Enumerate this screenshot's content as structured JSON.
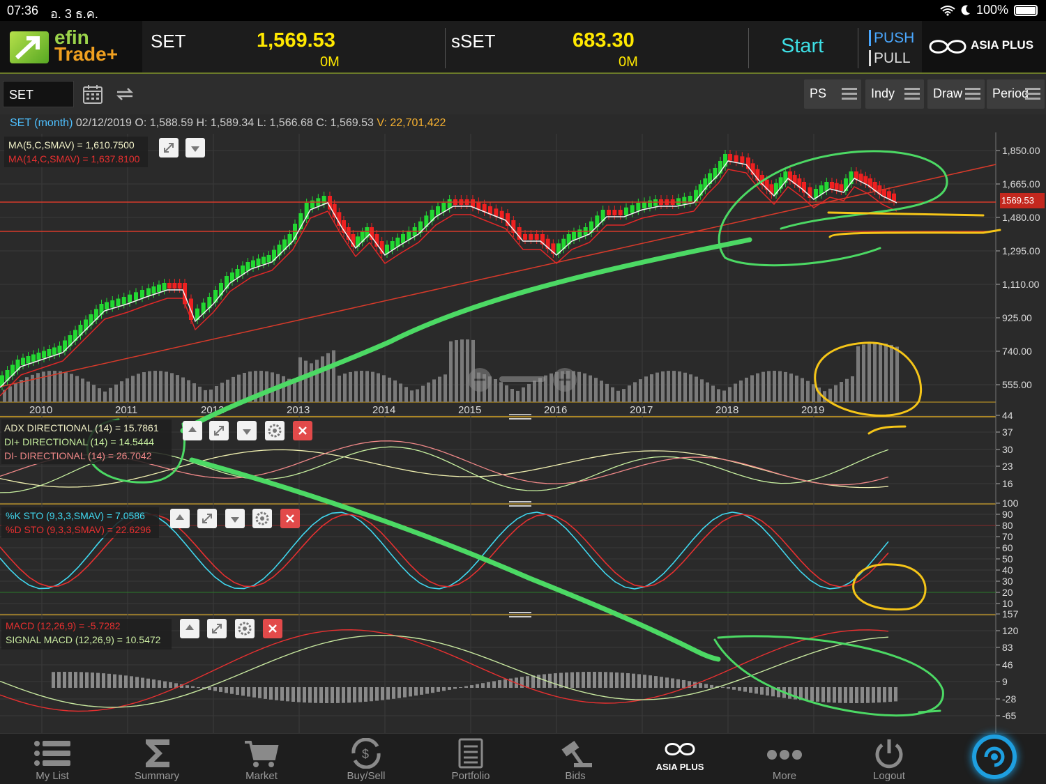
{
  "status_bar": {
    "time": "07:36",
    "date": "อ. 3 ธ.ค.",
    "battery": "100%"
  },
  "header": {
    "logo_line1": "efin",
    "logo_line2": "Trade+",
    "set": {
      "name": "SET",
      "value": "1,569.53",
      "volume": "0M"
    },
    "sset": {
      "name": "sSET",
      "value": "683.30",
      "volume": "0M"
    },
    "start_label": "Start",
    "push_label": "PUSH",
    "pull_label": "PULL",
    "broker_logo": "ASIA PLUS"
  },
  "toolbar": {
    "symbol": "SET",
    "calendar_icon": "calendar-icon",
    "refresh_icon": "refresh-icon",
    "buttons": [
      "PS",
      "Indy",
      "Draw",
      "Period"
    ]
  },
  "ohlc": {
    "symbol": "SET (month)",
    "date": "02/12/2019",
    "o_label": "O:",
    "o": "1,588.59",
    "h_label": "H:",
    "h": "1,589.34",
    "l_label": "L:",
    "l": "1,566.68",
    "c_label": "C:",
    "c": "1,569.53",
    "v_label": "V:",
    "v": "22,701,422"
  },
  "price_panel": {
    "legend": [
      "MA(5,C,SMAV) = 1,610.7500",
      "MA(14,C,SMAV) = 1,637.8100"
    ],
    "last_price_tag": "1569.53"
  },
  "adx_panel": {
    "legend": [
      "ADX DIRECTIONAL (14) = 15.7861",
      "DI+ DIRECTIONAL (14) = 14.5444",
      "DI- DIRECTIONAL (14) = 26.7042"
    ]
  },
  "sto_panel": {
    "legend": [
      "%K STO (9,3,3,SMAV) = 7.0586",
      "%D STO (9,3,3,SMAV) = 22.6296"
    ]
  },
  "macd_panel": {
    "legend": [
      "MACD (12,26,9) = -5.7282",
      "SIGNAL MACD (12,26,9) = 10.5472"
    ]
  },
  "chart_data": {
    "type": "line",
    "title": "SET (month)",
    "x_ticks": [
      "2010",
      "2011",
      "2012",
      "2013",
      "2014",
      "2015",
      "2016",
      "2017",
      "2018",
      "2019"
    ],
    "price_axis": [
      "1,850.00",
      "1,665.00",
      "1,480.00",
      "1,295.00",
      "1,110.00",
      "925.00",
      "740.00",
      "555.00"
    ],
    "adx_axis": [
      "44",
      "37",
      "30",
      "23",
      "16"
    ],
    "sto_axis": [
      "100",
      "90",
      "80",
      "70",
      "60",
      "50",
      "40",
      "30",
      "20",
      "10"
    ],
    "macd_axis": [
      "157",
      "120",
      "83",
      "46",
      "9",
      "-28",
      "-65"
    ],
    "series": [
      {
        "name": "MA(5,C,SMAV)",
        "color": "#ffffff"
      },
      {
        "name": "MA(14,C,SMAV)",
        "color": "#e83030"
      }
    ]
  },
  "bottom_nav": [
    {
      "label": "My List",
      "icon": "list-icon"
    },
    {
      "label": "Summary",
      "icon": "sigma-icon"
    },
    {
      "label": "Market",
      "icon": "cart-icon"
    },
    {
      "label": "Buy/Sell",
      "icon": "buy-sell-icon"
    },
    {
      "label": "Portfolio",
      "icon": "portfolio-icon"
    },
    {
      "label": "Bids",
      "icon": "gavel-icon"
    },
    {
      "label": "ASIA PLUS",
      "icon": "asia-plus-logo"
    },
    {
      "label": "More",
      "icon": "more-icon"
    },
    {
      "label": "Logout",
      "icon": "power-icon"
    }
  ]
}
